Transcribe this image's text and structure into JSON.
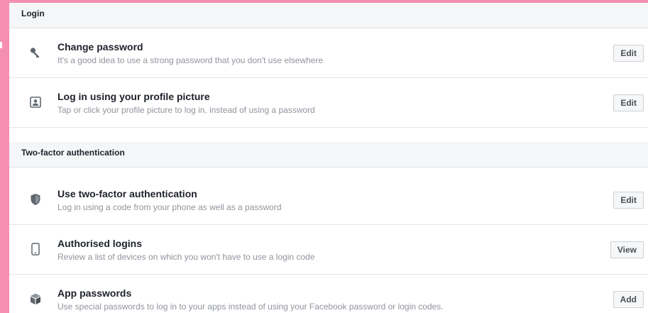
{
  "sections": {
    "login": {
      "title": "Login",
      "rows": [
        {
          "icon": "key-icon",
          "label": "Change password",
          "description": "It's a good idea to use a strong password that you don't use elsewhere",
          "action": "Edit"
        },
        {
          "icon": "profile-picture-icon",
          "label": "Log in using your profile picture",
          "description": "Tap or click your profile picture to log in, instead of using a password",
          "action": "Edit"
        }
      ]
    },
    "two_factor": {
      "title": "Two-factor authentication",
      "rows": [
        {
          "icon": "shield-icon",
          "label": "Use two-factor authentication",
          "description": "Log in using a code from your phone as well as a password",
          "action": "Edit"
        },
        {
          "icon": "phone-icon",
          "label": "Authorised logins",
          "description": "Review a list of devices on which you won't have to use a login code",
          "action": "View"
        },
        {
          "icon": "cube-icon",
          "label": "App passwords",
          "description": "Use special passwords to log in to your apps instead of using your Facebook password or login codes.",
          "action": "Add"
        }
      ]
    }
  },
  "colors": {
    "frame": "#f48fb1",
    "header_bg": "#f5f6f7",
    "text_primary": "#1d2129",
    "text_secondary": "#90949c",
    "icon": "#606770"
  }
}
